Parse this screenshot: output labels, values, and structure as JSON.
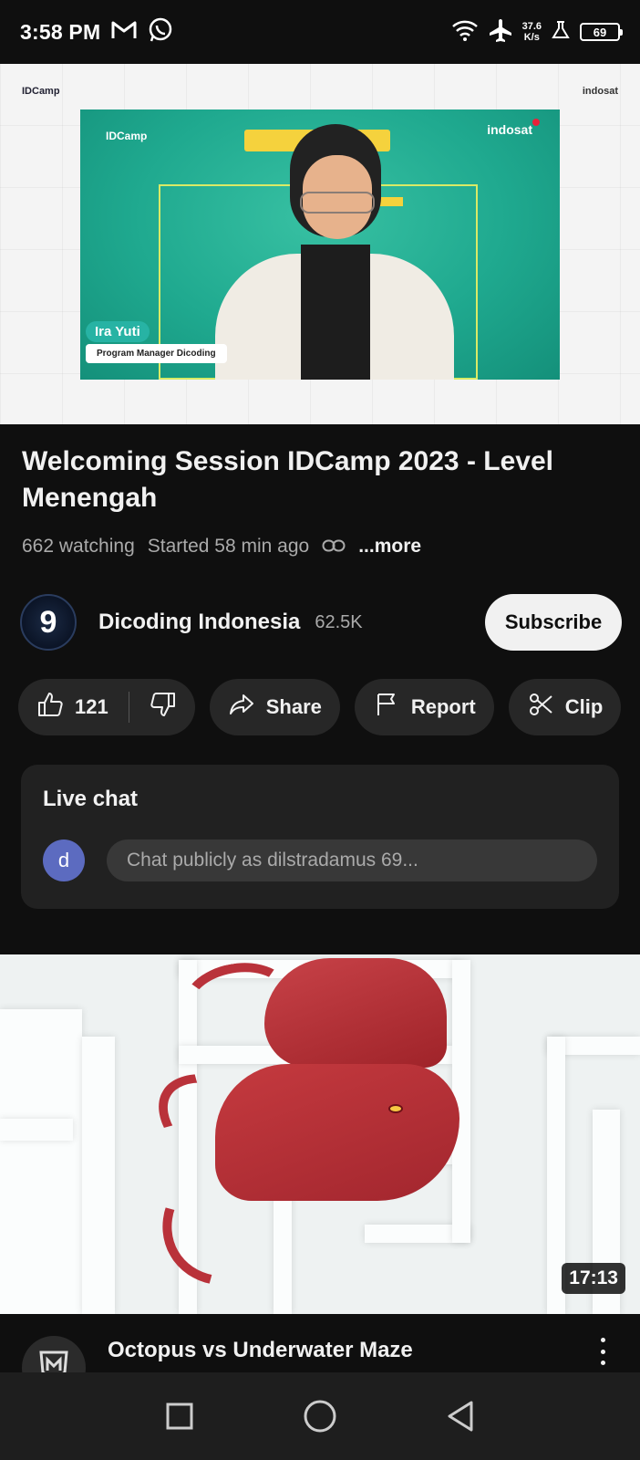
{
  "status_bar": {
    "time": "3:58 PM",
    "net_speed_value": "37.6",
    "net_speed_unit": "K/s",
    "battery": "69",
    "icons": [
      "gmail-icon",
      "whatsapp-icon",
      "wifi-icon",
      "airplane-mode-icon",
      "lab-icon",
      "battery-icon"
    ]
  },
  "player": {
    "overlay_logo_left": "IDCamp",
    "overlay_logo_right": "indosat",
    "frame_logo_left": "IDCamp",
    "frame_logo_right": "indosat",
    "speaker_name": "Ira Yuti",
    "speaker_role": "Program Manager Dicoding"
  },
  "video": {
    "title": "Welcoming Session IDCamp 2023 - Level Menengah",
    "watching": "662 watching",
    "started": "Started 58 min ago",
    "more_label": "...more"
  },
  "channel": {
    "avatar_letter": "9",
    "name": "Dicoding Indonesia",
    "subscribers": "62.5K",
    "subscribe_label": "Subscribe"
  },
  "actions": {
    "likes": "121",
    "share_label": "Share",
    "report_label": "Report",
    "clip_label": "Clip"
  },
  "live_chat": {
    "title": "Live chat",
    "user_initial": "d",
    "placeholder": "Chat publicly as dilstradamus 69..."
  },
  "next_video": {
    "title": "Octopus vs Underwater Maze",
    "duration": "17:13"
  },
  "nav": {
    "buttons": [
      "recents-square-icon",
      "home-circle-icon",
      "back-triangle-icon"
    ]
  }
}
